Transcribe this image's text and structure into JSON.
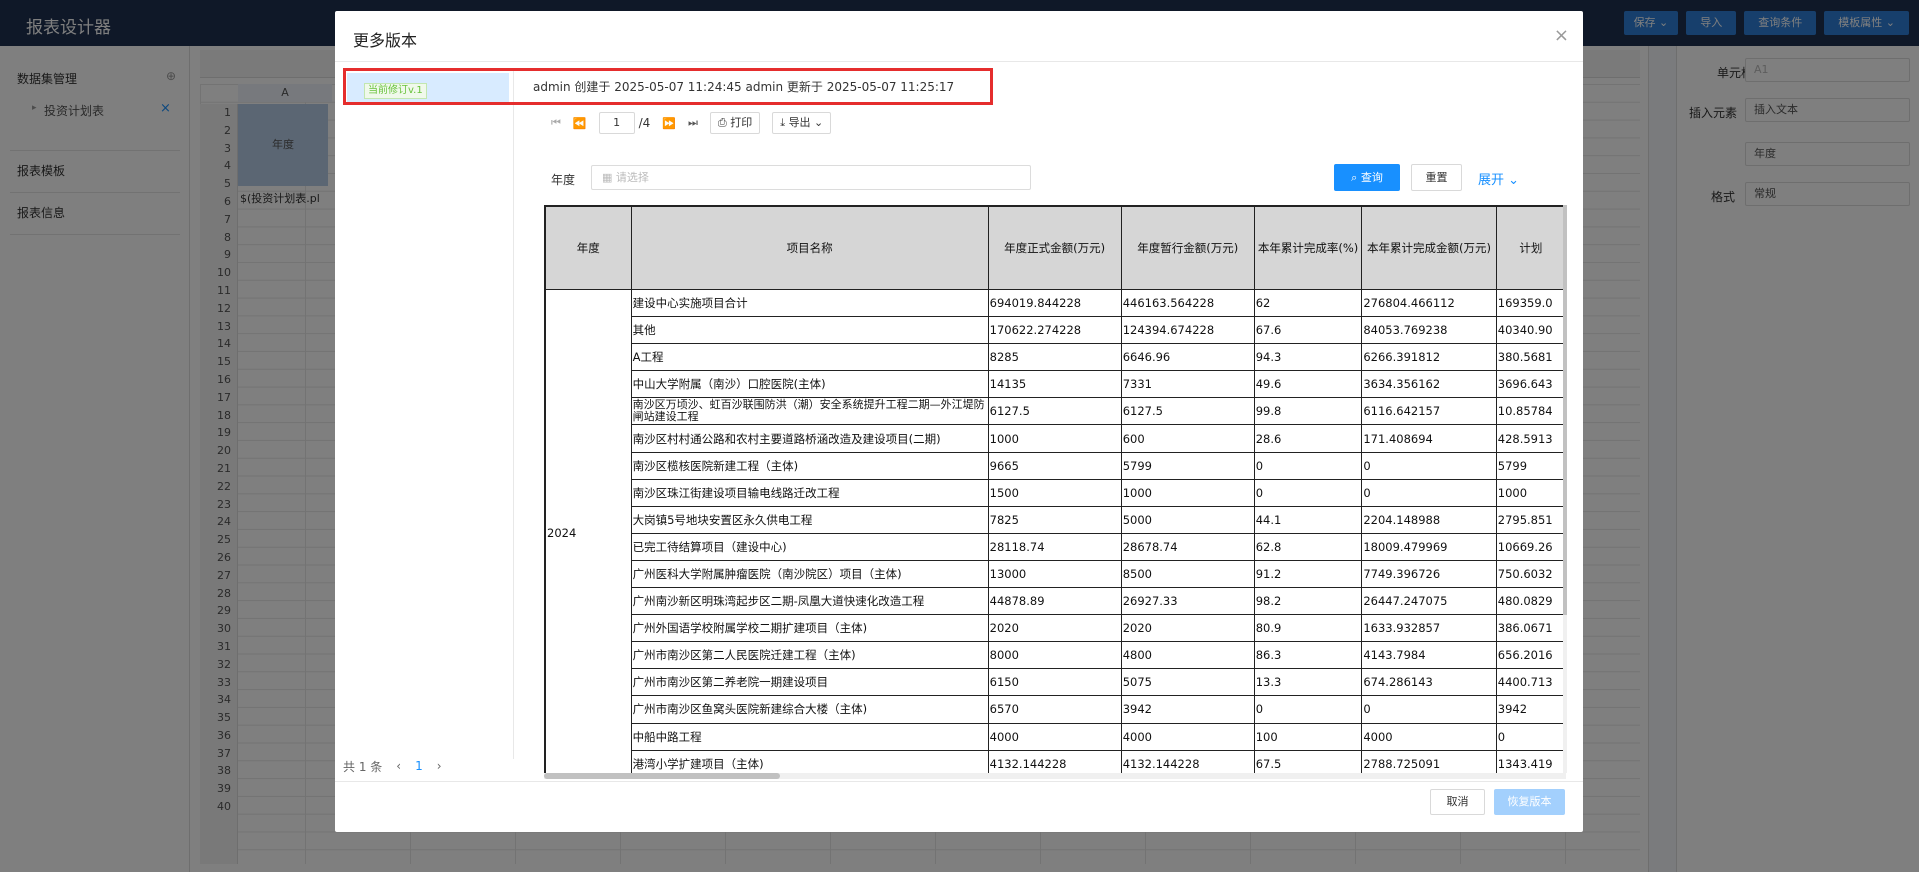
{
  "app": {
    "title": "报表设计器",
    "buttons": [
      "保存 ⌄",
      "导入",
      "查询条件",
      "模板属性 ⌄"
    ]
  },
  "left_panel": {
    "dataset_title": "数据集管理",
    "dataset_item": "投资计划表",
    "template_label": "报表模板",
    "info_label": "报表信息"
  },
  "sheet": {
    "col_a": "A",
    "cell_header": "年度",
    "cell_formula": "$(投资计划表.pl",
    "row_numbers": [
      "1",
      "2",
      "3",
      "4",
      "5",
      "6",
      "7",
      "8",
      "9",
      "10",
      "11",
      "12",
      "13",
      "14",
      "15",
      "16",
      "17",
      "18",
      "19",
      "20",
      "21",
      "22",
      "23",
      "24",
      "25",
      "26",
      "27",
      "28",
      "29",
      "30",
      "31",
      "32",
      "33",
      "34",
      "35",
      "36",
      "37",
      "38",
      "39",
      "40"
    ]
  },
  "right_panel": {
    "cell_label": "单元格",
    "cell_value": "A1",
    "insert_label": "插入元素",
    "insert_value": "插入文本",
    "text_value": "年度",
    "format_label": "格式",
    "format_value": "常规"
  },
  "dialog": {
    "title": "更多版本",
    "close": "×",
    "version_tag": "当前修订v.1",
    "version_meta": "admin 创建于 2025-05-07 11:24:45 admin 更新于 2025-05-07 11:25:17",
    "list_total": "共 1 条",
    "list_page": "1",
    "viewer": {
      "page_value": "1",
      "page_total": "/4",
      "print": "打印",
      "export": "导出"
    },
    "query": {
      "label": "年度",
      "placeholder": "请选择",
      "search": "查询",
      "reset": "重置",
      "expand": "展开"
    },
    "footer": {
      "cancel": "取消",
      "restore": "恢复版本"
    }
  },
  "report": {
    "headers": [
      "年度",
      "项目名称",
      "年度正式金额(万元)",
      "年度暂行金额(万元)",
      "本年累计完成率(%)",
      "本年累计完成金额(万元)",
      "计划"
    ],
    "year": "2024",
    "rows": [
      [
        "建设中心实施项目合计",
        "694019.844228",
        "446163.564228",
        "62",
        "276804.466112",
        "169359.0"
      ],
      [
        "其他",
        "170622.274228",
        "124394.674228",
        "67.6",
        "84053.769238",
        "40340.90"
      ],
      [
        "A工程",
        "8285",
        "6646.96",
        "94.3",
        "6266.391812",
        "380.5681"
      ],
      [
        "中山大学附属（南沙）口腔医院(主体)",
        "14135",
        "7331",
        "49.6",
        "3634.356162",
        "3696.643"
      ],
      [
        "南沙区万顷沙、虹百沙联围防洪（潮）安全系统提升工程二期—外江堤防闸站建设工程",
        "6127.5",
        "6127.5",
        "99.8",
        "6116.642157",
        "10.85784"
      ],
      [
        "南沙区村村通公路和农村主要道路桥涵改造及建设项目(二期)",
        "1000",
        "600",
        "28.6",
        "171.408694",
        "428.5913"
      ],
      [
        "南沙区榄核医院新建工程（主体)",
        "9665",
        "5799",
        "0",
        "0",
        "5799"
      ],
      [
        "南沙区珠江街建设项目输电线路迁改工程",
        "1500",
        "1000",
        "0",
        "0",
        "1000"
      ],
      [
        "大岗镇5号地块安置区永久供电工程",
        "7825",
        "5000",
        "44.1",
        "2204.148988",
        "2795.851"
      ],
      [
        "已完工待结算项目（建设中心)",
        "28118.74",
        "28678.74",
        "62.8",
        "18009.479969",
        "10669.26"
      ],
      [
        "广州医科大学附属肿瘤医院（南沙院区）项目（主体)",
        "13000",
        "8500",
        "91.2",
        "7749.396726",
        "750.6032"
      ],
      [
        "广州南沙新区明珠湾起步区二期-凤凰大道快速化改造工程",
        "44878.89",
        "26927.33",
        "98.2",
        "26447.247075",
        "480.0829"
      ],
      [
        "广州外国语学校附属学校二期扩建项目（主体)",
        "2020",
        "2020",
        "80.9",
        "1633.932857",
        "386.0671"
      ],
      [
        "广州市南沙区第二人民医院迁建工程（主体)",
        "8000",
        "4800",
        "86.3",
        "4143.7984",
        "656.2016"
      ],
      [
        "广州市南沙区第二养老院一期建设项目",
        "6150",
        "5075",
        "13.3",
        "674.286143",
        "4400.713"
      ],
      [
        "广州市南沙区鱼窝头医院新建综合大楼（主体)",
        "6570",
        "3942",
        "0",
        "0",
        "3942"
      ],
      [
        "中船中路工程",
        "4000",
        "4000",
        "100",
        "4000",
        "0"
      ],
      [
        "港湾小学扩建项目（主体)",
        "4132.144228",
        "4132.144228",
        "67.5",
        "2788.725091",
        "1343.419"
      ]
    ]
  }
}
